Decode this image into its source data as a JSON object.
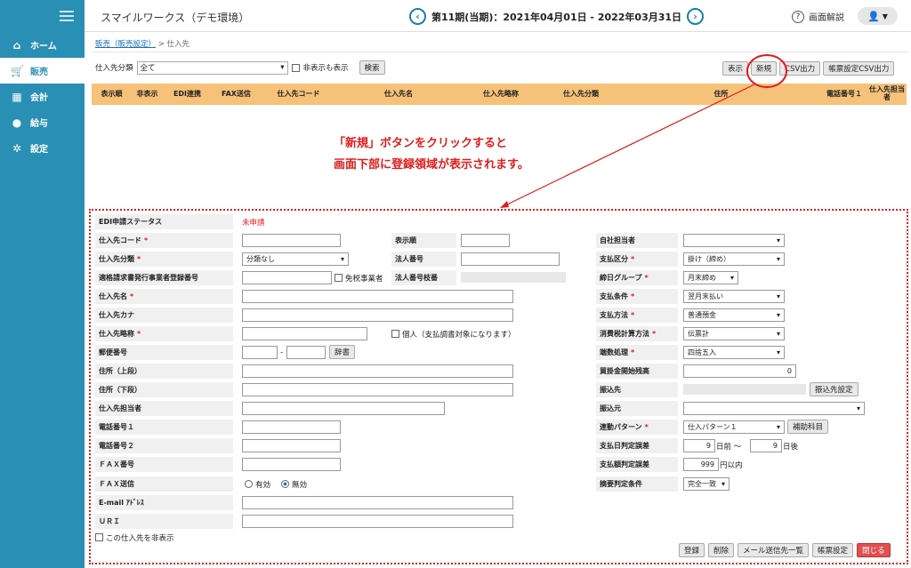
{
  "app": {
    "title": "スマイルワークス（デモ環境）",
    "period": "第11期(当期)：2021年04月01日 - 2022年03月31日",
    "help": "画面解説",
    "prev_icon": "chevron-left-icon",
    "next_icon": "chevron-right-icon",
    "help_icon": "question-icon",
    "user_icon": "user-icon"
  },
  "sidebar": {
    "items": [
      {
        "label": "ホーム",
        "icon": "home-icon"
      },
      {
        "label": "販売",
        "icon": "cart-icon"
      },
      {
        "label": "会計",
        "icon": "calculator-icon"
      },
      {
        "label": "給与",
        "icon": "money-bag-icon"
      },
      {
        "label": "設定",
        "icon": "gear-icon"
      }
    ],
    "active": "販売"
  },
  "breadcrumb": {
    "parent": "販売（販売設定）",
    "separator": ">",
    "current": "仕入先"
  },
  "filter": {
    "label": "仕入先分類",
    "value": "全て",
    "show_hidden": "非表示も表示",
    "search": "検索"
  },
  "toolbar": {
    "display": "表示",
    "new": "新規",
    "csv": "CSV出力",
    "form_csv": "帳票設定CSV出力"
  },
  "table": {
    "headers": [
      "表示順",
      "非表示",
      "EDI連携",
      "FAX送信",
      "仕入先コード",
      "仕入先名",
      "仕入先略称",
      "仕入先分類",
      "住所",
      "電話番号１",
      "仕入先担当者"
    ]
  },
  "annotation": {
    "line1": "「新規」ボタンをクリックすると",
    "line2": "画面下部に登録領域が表示されます。"
  },
  "form": {
    "edi_status_label": "EDI申請ステータス",
    "edi_status_value": "未申請",
    "code_label": "仕入先コード",
    "category_label": "仕入先分類",
    "category_value": "分類なし",
    "invoice_label": "適格請求書発行事業者登録番号",
    "tax_exempt": "免税事業者",
    "name_label": "仕入先名",
    "kana_label": "仕入先カナ",
    "short_label": "仕入先略称",
    "individual": "個人（支払調書対象になります）",
    "zip_label": "郵便番号",
    "zip_sep": "-",
    "dict": "辞書",
    "addr1_label": "住所（上段）",
    "addr2_label": "住所（下段）",
    "contact_label": "仕入先担当者",
    "tel1_label": "電話番号１",
    "tel2_label": "電話番号２",
    "fax_label": "ＦＡＸ番号",
    "faxsend_label": "ＦＡＸ送信",
    "faxsend_on": "有効",
    "faxsend_off": "無効",
    "email_label": "E-mail ｱﾄﾞﾚｽ",
    "url_label": "ＵＲＩ",
    "hide": "この仕入先を非表示",
    "order_label": "表示順",
    "corp_label": "法人番号",
    "corp_branch_label": "法人番号枝番",
    "staff_label": "自社担当者",
    "pay_type_label": "支払区分",
    "pay_type_value": "掛け（締め）",
    "close_label": "締日グループ",
    "close_value": "月末締め",
    "pay_cond_label": "支払条件",
    "pay_cond_value": "翌月末払い",
    "pay_method_label": "支払方法",
    "pay_method_value": "普通預金",
    "tax_calc_label": "消費税計算方法",
    "tax_calc_value": "伝票計",
    "round_label": "端数処理",
    "round_value": "四捨五入",
    "balance_label": "買掛金開始残高",
    "balance_value": "0",
    "bank_label": "振込先",
    "bank_btn": "振込先設定",
    "from_label": "振込元",
    "link_label": "連動パターン",
    "link_value": "仕入パターン１",
    "link_btn": "補助科目",
    "day_err_label": "支払日判定誤差",
    "day_before": "9",
    "day_before_unit": "日前 ～",
    "day_after": "9",
    "day_after_unit": "日後",
    "amt_err_label": "支払額判定誤差",
    "amt_value": "999",
    "amt_unit": "円以内",
    "match_label": "摘要判定条件",
    "match_value": "完全一致"
  },
  "actions": {
    "register": "登録",
    "delete": "削除",
    "mail": "メール送信先一覧",
    "form_settings": "帳票設定",
    "close": "閉じる"
  }
}
